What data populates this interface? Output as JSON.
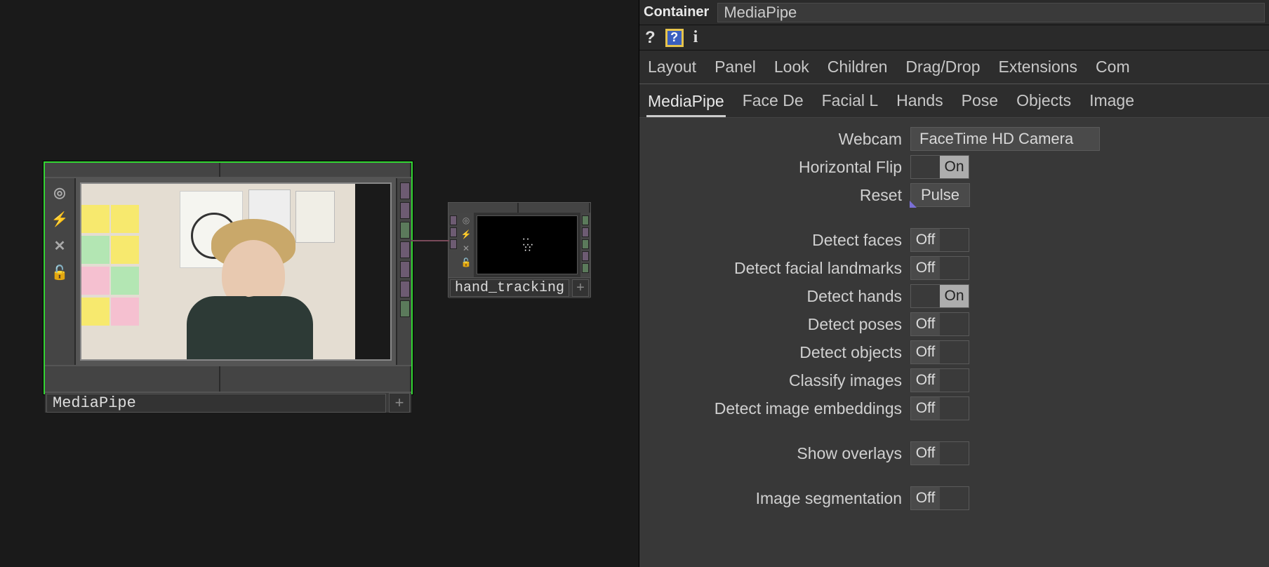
{
  "header": {
    "opTypeLabel": "Container",
    "opName": "MediaPipe"
  },
  "tabsOuter": [
    "Layout",
    "Panel",
    "Look",
    "Children",
    "Drag/Drop",
    "Extensions",
    "Com"
  ],
  "tabsInner": [
    "MediaPipe",
    "Face De",
    "Facial L",
    "Hands",
    "Pose",
    "Objects",
    "Image "
  ],
  "params": {
    "webcam": {
      "label": "Webcam",
      "value": "FaceTime HD Camera"
    },
    "hflip": {
      "label": "Horizontal Flip",
      "on": "On"
    },
    "reset": {
      "label": "Reset",
      "value": "Pulse"
    },
    "faces": {
      "label": "Detect faces",
      "off": "Off"
    },
    "flm": {
      "label": "Detect facial landmarks",
      "off": "Off"
    },
    "hands": {
      "label": "Detect hands",
      "on": "On"
    },
    "poses": {
      "label": "Detect poses",
      "off": "Off"
    },
    "objects": {
      "label": "Detect objects",
      "off": "Off"
    },
    "classify": {
      "label": "Classify images",
      "off": "Off"
    },
    "embed": {
      "label": "Detect image embeddings",
      "off": "Off"
    },
    "overlay": {
      "label": "Show overlays",
      "off": "Off"
    },
    "seg": {
      "label": "Image segmentation",
      "off": "Off"
    }
  },
  "nodes": {
    "mediapipe": {
      "label": "MediaPipe"
    },
    "handtracking": {
      "label": "hand_tracking"
    }
  }
}
